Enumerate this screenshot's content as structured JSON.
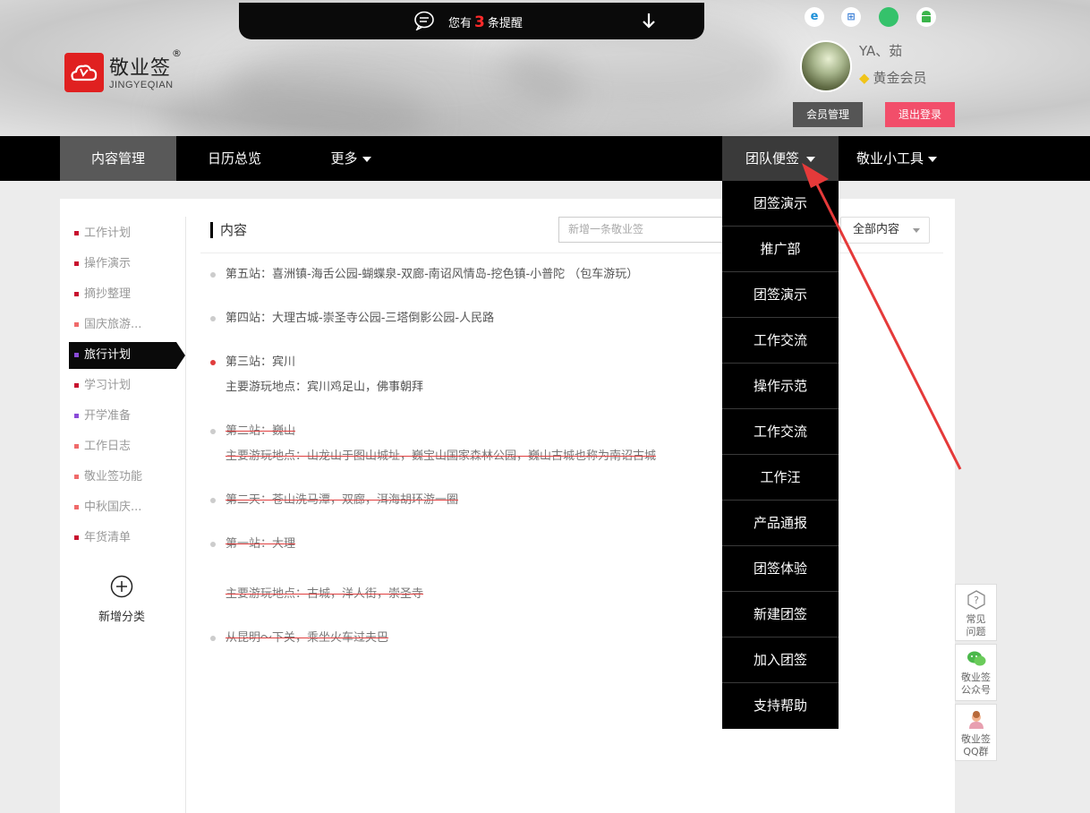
{
  "brand": {
    "name": "敬业签",
    "reg": "®",
    "pinyin": "JINGYEQIAN"
  },
  "notice": {
    "prefix": "您有",
    "count": "3",
    "suffix": "条提醒"
  },
  "platforms": [
    "ie-icon",
    "windows-icon",
    "apple-icon",
    "android-icon"
  ],
  "user": {
    "name": "YA、茹",
    "level": "黄金会员",
    "member_btn": "会员管理",
    "logout_btn": "退出登录"
  },
  "nav": {
    "items": [
      "内容管理",
      "日历总览",
      "更多"
    ],
    "right": [
      "团队便签",
      "敬业小工具"
    ]
  },
  "sidebar": {
    "categories": [
      {
        "label": "工作计划",
        "color": "#c8102e"
      },
      {
        "label": "操作演示",
        "color": "#c8102e"
      },
      {
        "label": "摘抄整理",
        "color": "#c8102e"
      },
      {
        "label": "国庆旅游...",
        "color": "#f06a6a"
      },
      {
        "label": "旅行计划",
        "color": "#8a4bd8"
      },
      {
        "label": "学习计划",
        "color": "#c8102e"
      },
      {
        "label": "开学准备",
        "color": "#8a4bd8"
      },
      {
        "label": "工作日志",
        "color": "#f06a6a"
      },
      {
        "label": "敬业签功能",
        "color": "#f06a6a"
      },
      {
        "label": "中秋国庆...",
        "color": "#f06a6a"
      },
      {
        "label": "年货清单",
        "color": "#c8102e"
      }
    ],
    "add_label": "新增分类"
  },
  "main": {
    "title": "内容",
    "new_placeholder": "新增一条敬业签",
    "filter": "全部内容",
    "items": [
      {
        "text": "第五站：喜洲镇-海舌公园-蝴蝶泉-双廊-南诏风情岛-挖色镇-小普陀 （包车游玩）",
        "done": false
      },
      {
        "text": "第四站：大理古城-崇圣寺公园-三塔倒影公园-人民路",
        "done": false
      },
      {
        "text": "第三站：宾川",
        "detail": "主要游玩地点：宾川鸡足山，佛事朝拜",
        "done": false,
        "highlight": true
      },
      {
        "text": "第二站：巍山",
        "detail": "主要游玩地点：山龙山于图山城址，巍宝山国家森林公园，巍山古城也称为南诏古城",
        "done": true
      },
      {
        "text": "第二天：苍山洗马潭，双廊，洱海胡环游一圈",
        "done": true
      },
      {
        "text": "第一站：大理",
        "detail": "主要游玩地点：古城，洋人街，崇圣寺",
        "done": true
      },
      {
        "text": "从昆明～下关，乘坐火车过夫巴",
        "done": true
      }
    ]
  },
  "dropdown": [
    "团签演示",
    "推广部",
    "团签演示",
    "工作交流",
    "操作示范",
    "工作交流",
    "工作汪",
    "产品通报",
    "团签体验",
    "新建团签",
    "加入团签",
    "支持帮助"
  ],
  "floating": [
    {
      "label": "常见问题",
      "icon": "question-icon"
    },
    {
      "label": "敬业签公众号",
      "icon": "wechat-icon"
    },
    {
      "label": "敬业签QQ群",
      "icon": "qq-icon"
    }
  ]
}
